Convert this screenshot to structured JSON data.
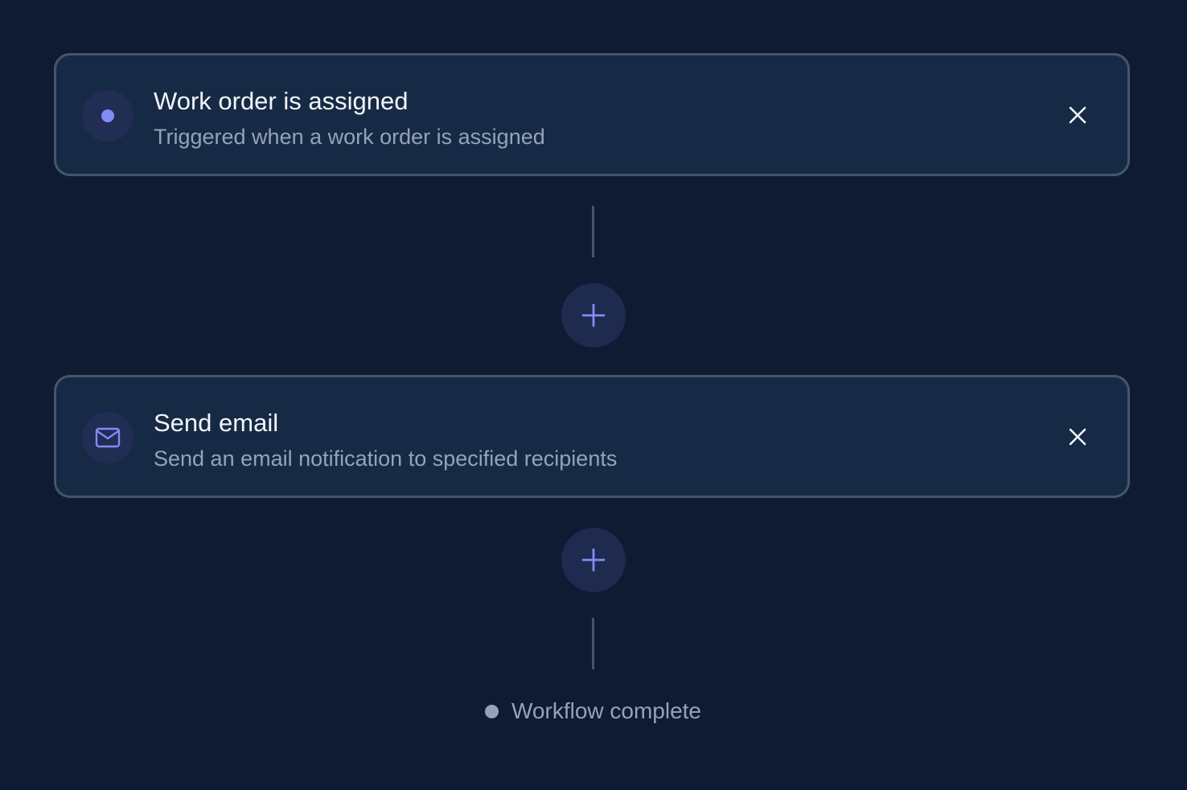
{
  "workflow": {
    "steps": [
      {
        "title": "Work order is assigned",
        "description": "Triggered when a work order is assigned",
        "icon": "dot-icon",
        "kind": "trigger"
      },
      {
        "title": "Send email",
        "description": "Send an email notification to specified recipients",
        "icon": "mail-icon",
        "kind": "action"
      }
    ],
    "end_label": "Workflow complete"
  },
  "colors": {
    "background": "#0f1b33",
    "card": "#172a45",
    "card_border": "#475569",
    "accent": "#818cf8",
    "title": "#f1f5f9",
    "muted": "#94a3b8"
  }
}
